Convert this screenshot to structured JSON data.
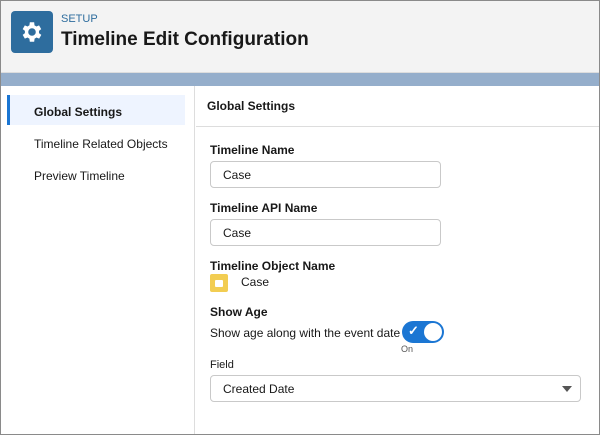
{
  "header": {
    "eyebrow": "SETUP",
    "title": "Timeline Edit Configuration",
    "icon": "gear-icon"
  },
  "sidebar": {
    "items": [
      {
        "label": "Global Settings",
        "active": true
      },
      {
        "label": "Timeline Related Objects"
      },
      {
        "label": "Preview Timeline"
      }
    ]
  },
  "main": {
    "section_title": "Global Settings",
    "timeline_name": {
      "label": "Timeline Name",
      "value": "Case"
    },
    "api_name": {
      "label": "Timeline API Name",
      "value": "Case"
    },
    "object_name": {
      "label": "Timeline Object Name",
      "value": "Case",
      "icon": "case-icon"
    },
    "show_age": {
      "label": "Show Age",
      "description": "Show age along with the event date",
      "state": "On",
      "checked": true
    },
    "field": {
      "label": "Field",
      "value": "Created Date"
    }
  },
  "colors": {
    "brand": "#2e6d9e",
    "accent": "#1b76d3",
    "object_icon": "#f2cd52"
  }
}
